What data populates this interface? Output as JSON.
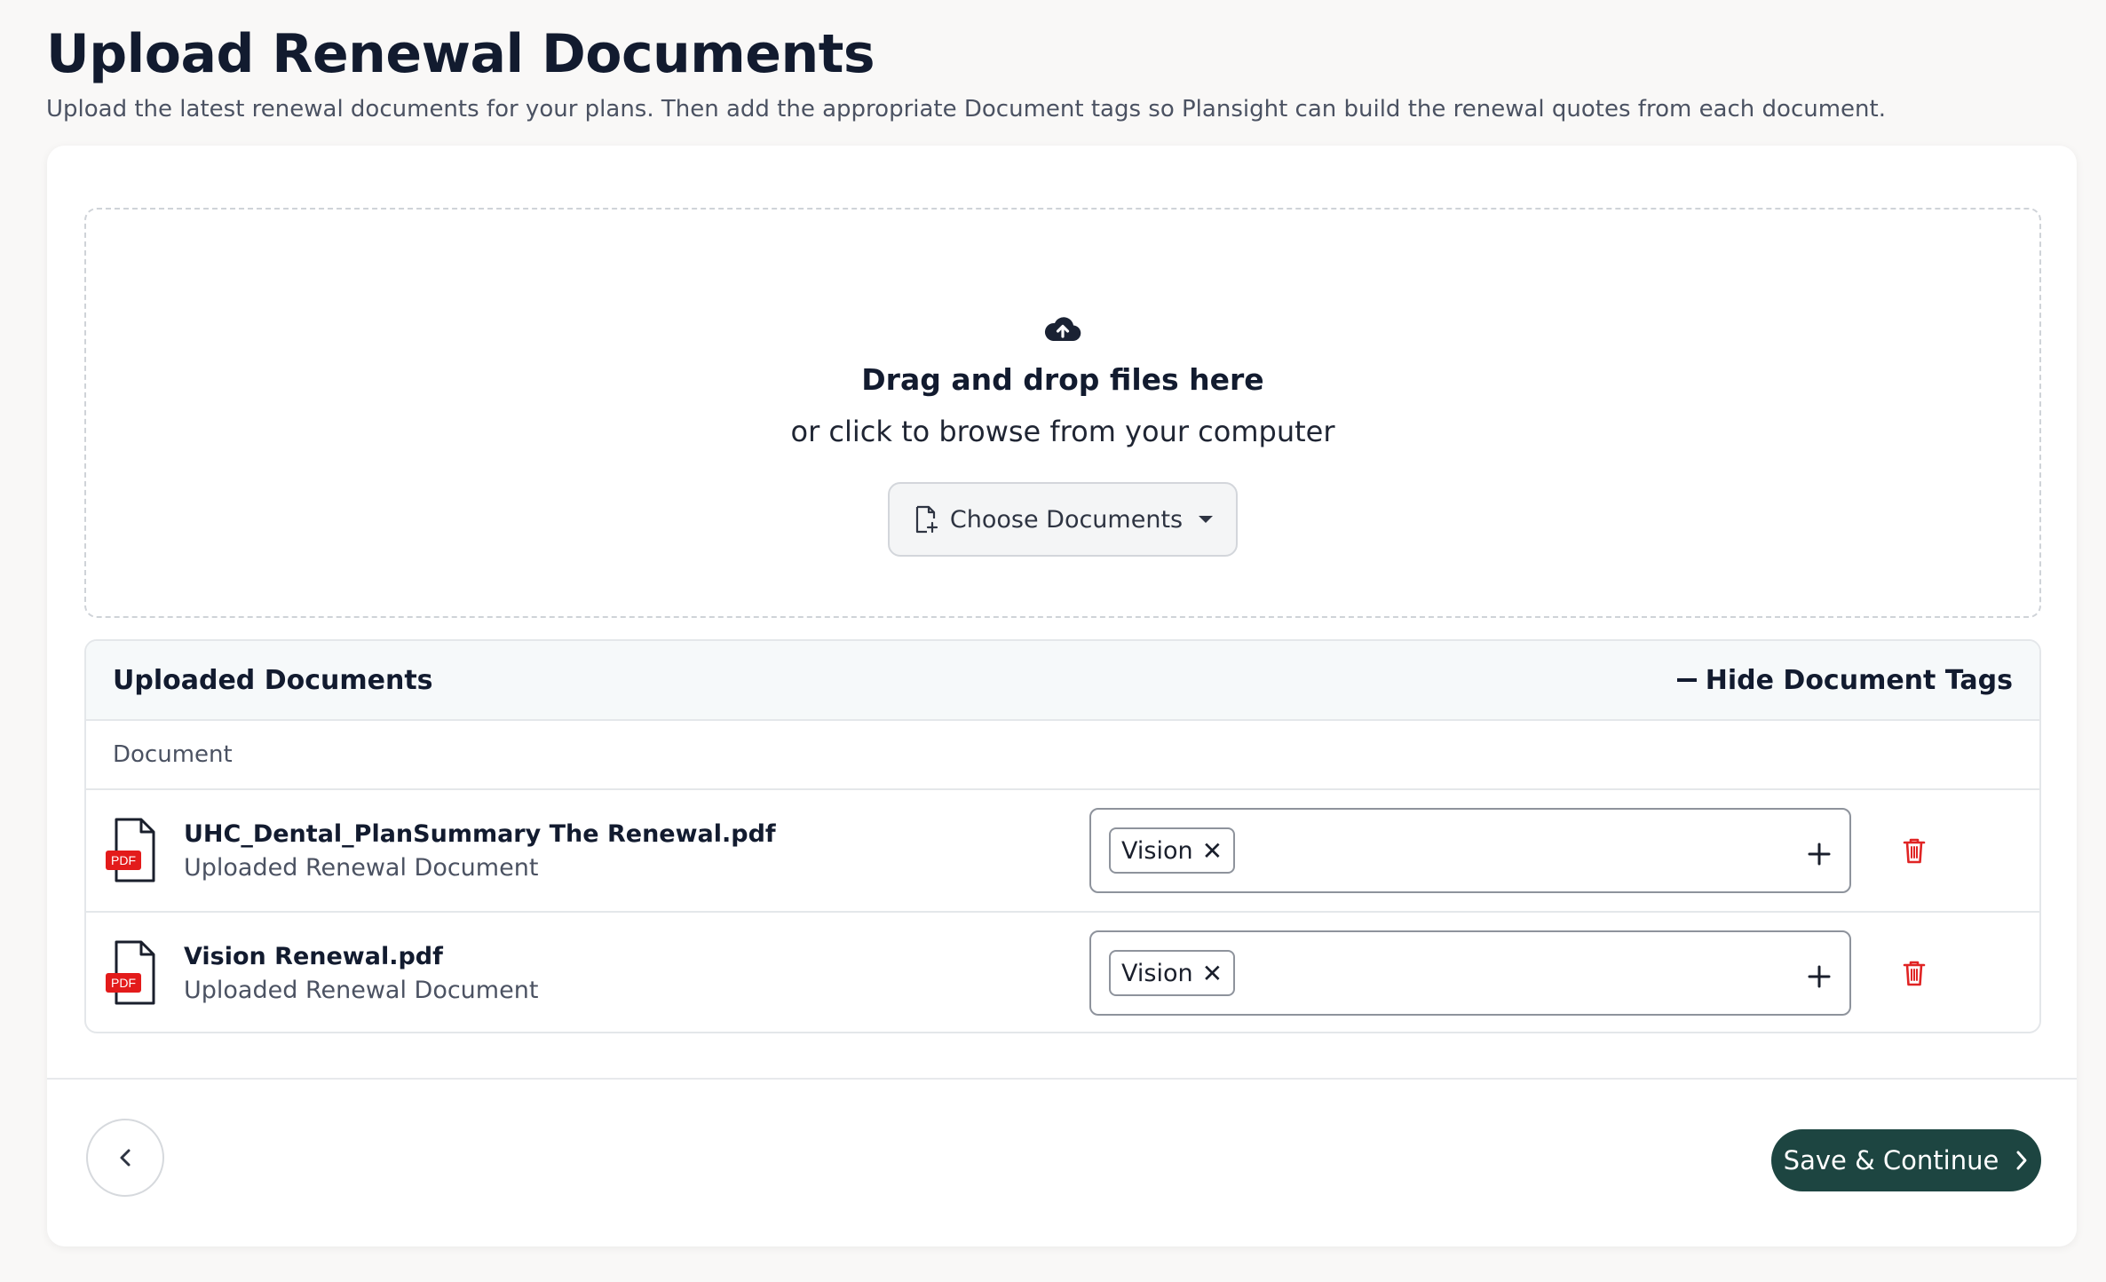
{
  "page": {
    "title": "Upload Renewal Documents",
    "subtitle": "Upload the latest renewal documents for your plans. Then add the appropriate Document tags so Plansight can build the renewal quotes from each document."
  },
  "dropzone": {
    "title": "Drag and drop files here",
    "subtitle": "or click to browse from your computer",
    "choose_label": "Choose Documents"
  },
  "uploaded": {
    "title": "Uploaded Documents",
    "toggle_label": "Hide Document Tags",
    "column_header": "Document",
    "rows": [
      {
        "file_badge": "PDF",
        "name": "UHC_Dental_PlanSummary The Renewal.pdf",
        "meta": "Uploaded Renewal Document",
        "tags": [
          "Vision"
        ]
      },
      {
        "file_badge": "PDF",
        "name": "Vision Renewal.pdf",
        "meta": "Uploaded Renewal Document",
        "tags": [
          "Vision"
        ]
      }
    ]
  },
  "footer": {
    "save_label": "Save & Continue"
  },
  "colors": {
    "primary": "#1d4541",
    "danger": "#e02424",
    "pdf_badge": "#e31b1b",
    "text": "#121b2f"
  },
  "icons": {
    "upload": "cloud-upload-icon",
    "choose": "document-add-icon",
    "file": "pdf-file-icon",
    "remove_tag": "close-icon",
    "add_tag": "plus-icon",
    "delete": "trash-icon",
    "back": "chevron-left-icon",
    "forward": "chevron-right-icon"
  }
}
